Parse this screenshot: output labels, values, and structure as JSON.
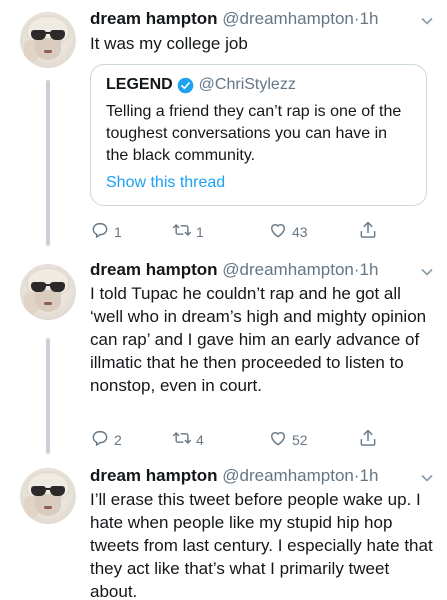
{
  "tweets": [
    {
      "author_name": "dream hampton",
      "handle": "@dreamhampton",
      "separator": "·",
      "time": "1h",
      "text": "It was my college job",
      "quote": {
        "author_name": "LEGEND",
        "handle": "@ChriStylezz",
        "text": "Telling a friend they can’t rap is one of the toughest conversations you can have in the black community.",
        "link": "Show this thread"
      },
      "replies": "1",
      "retweets": "1",
      "likes": "43"
    },
    {
      "author_name": "dream hampton",
      "handle": "@dreamhampton",
      "separator": "·",
      "time": "1h",
      "text": "I told Tupac he couldn’t rap and he got all ‘well who in dream’s high and mighty opinion can rap’ and I gave him an early advance of illmatic that he then proceeded to listen to nonstop, even in court.",
      "replies": "2",
      "retweets": "4",
      "likes": "52"
    },
    {
      "author_name": "dream hampton",
      "handle": "@dreamhampton",
      "separator": "·",
      "time": "1h",
      "text": "I’ll erase this tweet before people wake up. I hate when people like my stupid hip hop tweets from last century. I especially hate that they act like that’s what I primarily tweet about."
    }
  ],
  "colors": {
    "accent": "#1da1f2",
    "secondary_text": "#657786",
    "thread_line": "#c8d1d9",
    "border": "#ccd6dd"
  },
  "icons": [
    "reply-icon",
    "retweet-icon",
    "like-icon",
    "share-icon",
    "verified-badge-icon",
    "caret-down-icon"
  ]
}
